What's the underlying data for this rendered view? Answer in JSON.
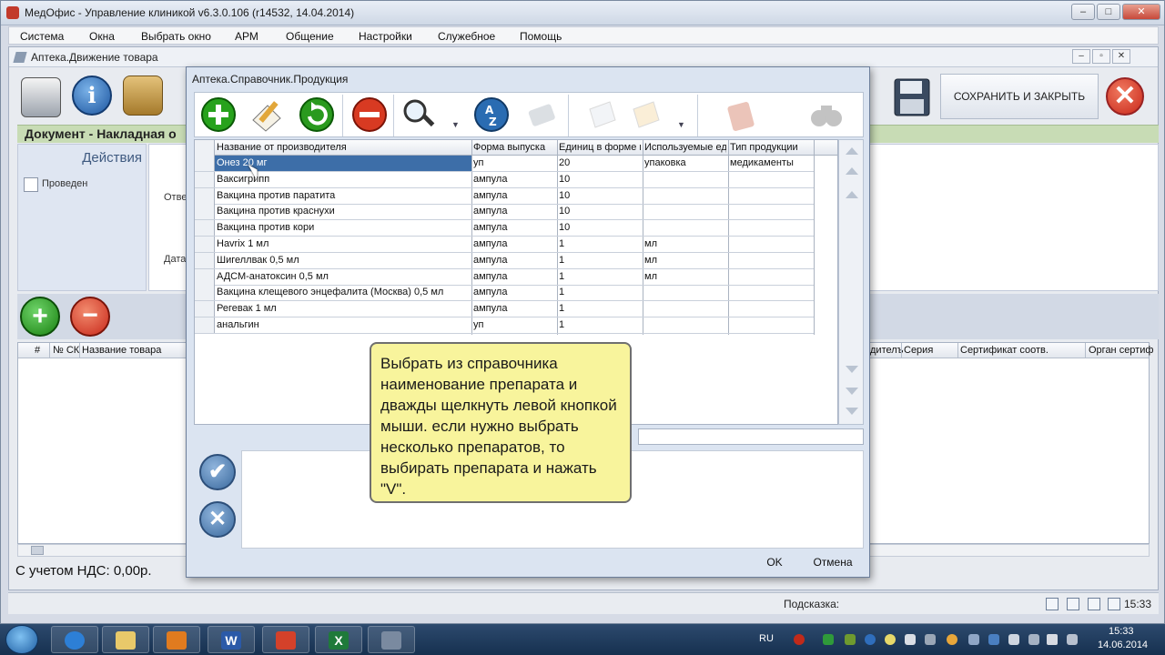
{
  "app": {
    "title": "МедОфис - Управление клиникой v6.3.0.106 (r14532, 14.04.2014)",
    "win_min": "–",
    "win_max": "□",
    "win_close": "✕"
  },
  "menu": [
    "Система",
    "Окна",
    "Выбрать окно",
    "АРМ",
    "Общение",
    "Настройки",
    "Служебное",
    "Помощь"
  ],
  "inner": {
    "title": "Аптека.Движение товара",
    "btn_min": "–",
    "btn_max": "▫",
    "btn_close": "✕"
  },
  "toolbar_right": {
    "save_close": "СОХРАНИТЬ И ЗАКРЫТЬ",
    "close_glyph": "✕"
  },
  "document": {
    "title": "Документ - Накладная о",
    "actions": "Действия",
    "posted_label": "Проведен",
    "label_resp": "Отве",
    "label_date": "Дата"
  },
  "lower_table": {
    "columns": [
      "#",
      "№ СК",
      "Название товара",
      "дителъ",
      "Серия",
      "Сертификат соотв.",
      "Орган сертиф"
    ]
  },
  "footer": {
    "total": "С учетом НДС: 0,00р.",
    "hint": "Подсказка:",
    "time": "15:33"
  },
  "dialog": {
    "title": "Аптека.Справочник.Продукция",
    "columns": [
      "Название от производителя",
      "Форма выпуска",
      "Единиц в форме вы",
      "Используемые еди",
      "Тип продукции"
    ],
    "rows": [
      [
        "Онез 20 мг",
        "уп",
        "20",
        "упаковка",
        "медикаменты"
      ],
      [
        "Ваксигрипп",
        "ампула",
        "10",
        "",
        ""
      ],
      [
        "Вакцина против паратита",
        "ампула",
        "10",
        "",
        ""
      ],
      [
        "Вакцина против краснухи",
        "ампула",
        "10",
        "",
        ""
      ],
      [
        "Вакцина против кори",
        "ампула",
        "10",
        "",
        ""
      ],
      [
        "Havrix 1 мл",
        "ампула",
        "1",
        "мл",
        ""
      ],
      [
        "Шигеллвак 0,5 мл",
        "ампула",
        "1",
        "мл",
        ""
      ],
      [
        "АДСМ-анатоксин 0,5 мл",
        "ампула",
        "1",
        "мл",
        ""
      ],
      [
        "Вакцина клещевого энцефалита (Москва) 0,5 мл",
        "ампула",
        "1",
        "",
        ""
      ],
      [
        "Регевак 1 мл",
        "ампула",
        "1",
        "",
        ""
      ],
      [
        "анальгин",
        "уп",
        "1",
        "",
        ""
      ]
    ],
    "ok": "OK",
    "cancel": "Отмена",
    "confirm_glyph": "✔",
    "cancel_glyph": "✕"
  },
  "tooltip": "Выбрать из справочника наименование препарата и дважды щелкнуть левой кнопкой мыши. если нужно выбрать несколько препаратов, то выбирать препарата и нажать \"V\".",
  "taskbar": {
    "lang": "RU",
    "time": "15:33",
    "date": "14.06.2014",
    "word_glyph": "W",
    "excel_glyph": "X"
  }
}
